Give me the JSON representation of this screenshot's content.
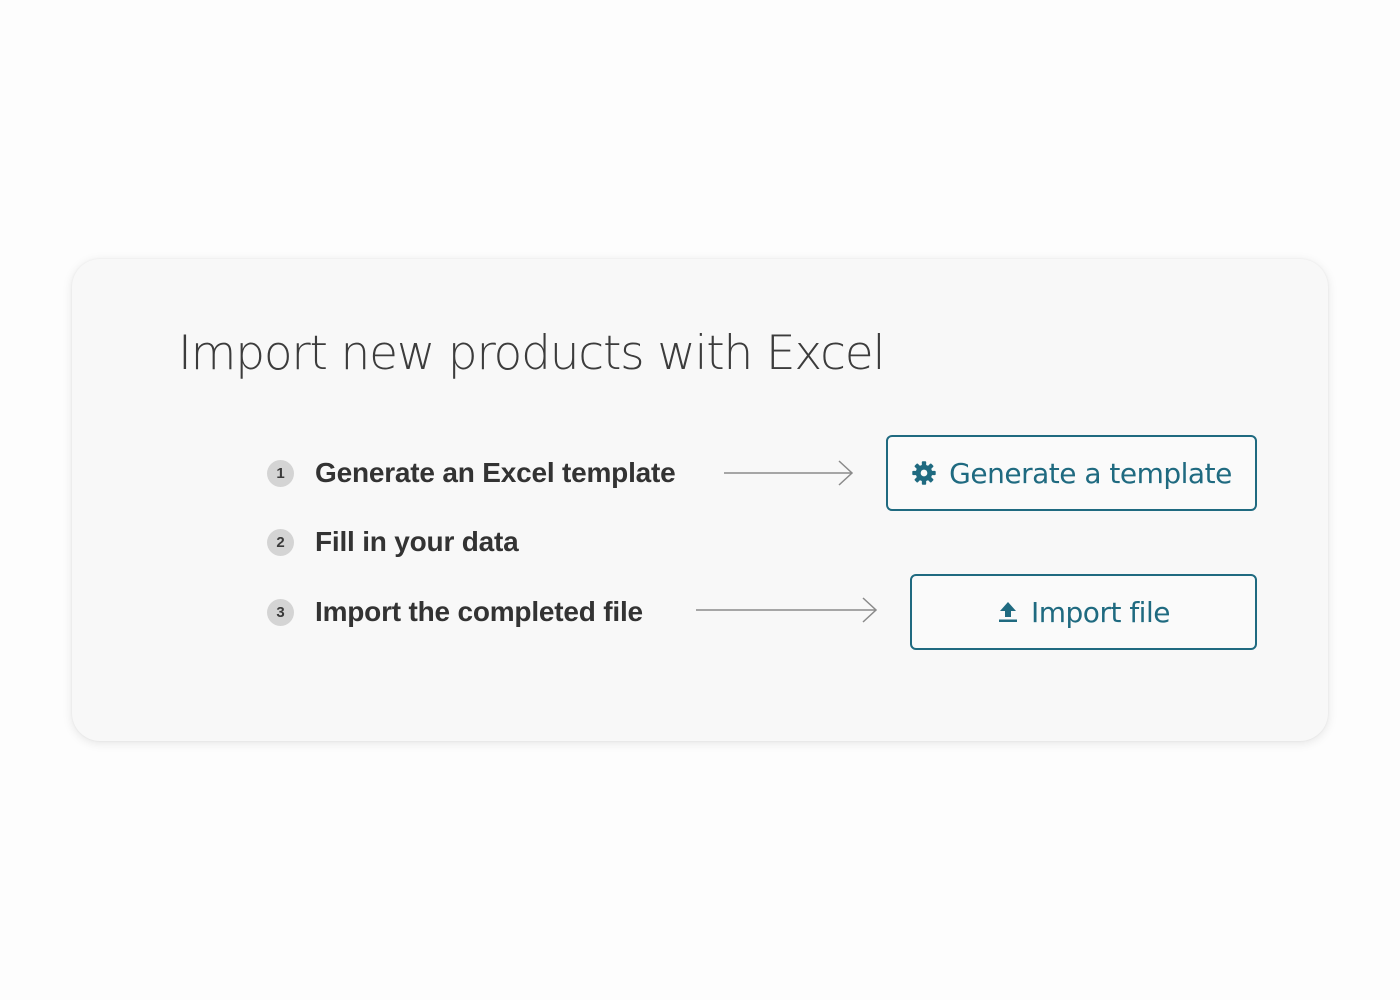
{
  "card": {
    "title": "Import new products with Excel"
  },
  "steps": [
    {
      "number": "1",
      "label": "Generate an Excel template"
    },
    {
      "number": "2",
      "label": "Fill in your data"
    },
    {
      "number": "3",
      "label": "Import the completed file"
    }
  ],
  "actions": {
    "generate_template_label": "Generate a template",
    "generate_template_icon": "gear-icon",
    "import_file_label": "Import file",
    "import_file_icon": "upload-icon"
  },
  "colors": {
    "accent": "#1f6a80",
    "step_badge": "#d4d4d4",
    "card_background": "#f8f8f8"
  }
}
